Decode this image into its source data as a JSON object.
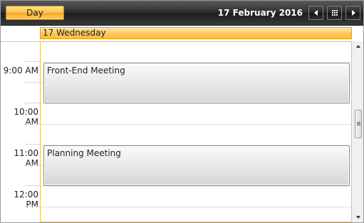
{
  "toolbar": {
    "view_label": "Day",
    "current_date": "17 February 2016"
  },
  "day": {
    "header": "17 Wednesday"
  },
  "time_labels": [
    "9:00 AM",
    "10:00 AM",
    "11:00 AM",
    "12:00 PM"
  ],
  "appointments": [
    {
      "title": "Front-End Meeting",
      "start": "9:00 AM",
      "end": "10:00 AM"
    },
    {
      "title": "Planning Meeting",
      "start": "11:00 AM",
      "end": "12:00 PM"
    }
  ],
  "icons": {
    "prev": "triangle-left-icon",
    "today": "calendar-grid-icon",
    "next": "triangle-right-icon",
    "scroll_up": "triangle-up-icon",
    "scroll_down": "triangle-down-icon"
  },
  "colors": {
    "accent": "#ffc24a",
    "header_bg": "#2f2f2f",
    "day_border": "#f0c040"
  }
}
